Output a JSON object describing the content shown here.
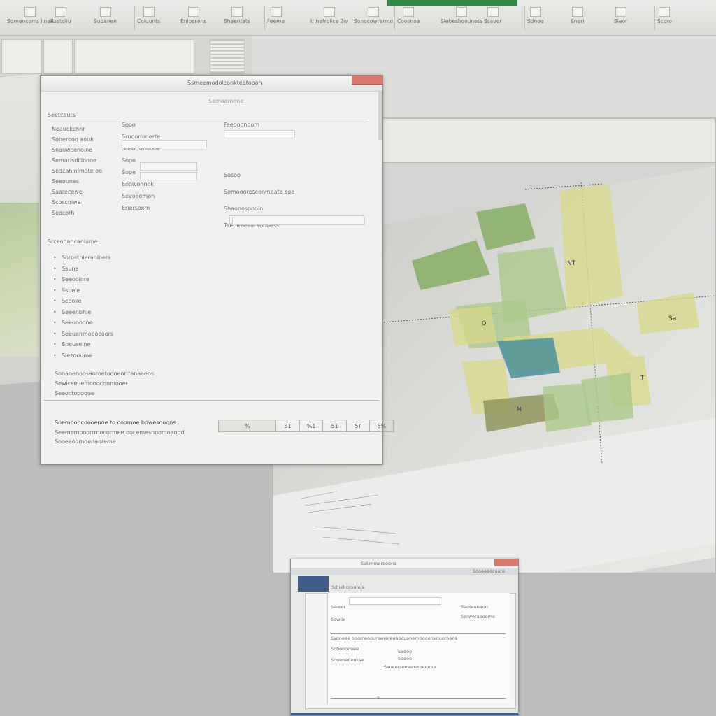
{
  "ribbon": {
    "tab_accent": "#2f8a43",
    "items": [
      {
        "label": "Sdmencoms lines",
        "icon": "table-icon"
      },
      {
        "label": "Rsstdiiu",
        "icon": "doc-icon"
      },
      {
        "label": "Sudanen",
        "icon": "doc-icon"
      },
      {
        "label": "Coiuunts",
        "icon": "grid-icon"
      },
      {
        "label": "Enlossons",
        "icon": "chart-icon"
      },
      {
        "label": "Shaentats",
        "icon": "shape-icon"
      },
      {
        "label": "Feeme",
        "icon": "doc-icon"
      },
      {
        "label": "Ir hefrolice 2w",
        "icon": "doc-icon"
      },
      {
        "label": "Sonocowrarmo",
        "icon": "doc-icon"
      },
      {
        "label": "Coosnoe",
        "icon": "chart-icon"
      },
      {
        "label": "Siebeshoouness",
        "icon": "list-icon"
      },
      {
        "label": "Ssaver",
        "icon": "doc-icon"
      },
      {
        "label": "Sdnoe",
        "icon": "image-icon"
      },
      {
        "label": "Sneri",
        "icon": "shape-icon"
      },
      {
        "label": "Siaor",
        "icon": "doc-icon"
      },
      {
        "label": "Scoro",
        "icon": "shape-icon"
      }
    ]
  },
  "dialog": {
    "title": "Ssmeemodolconkteatooon",
    "subtitle": "Semoemone",
    "section": "Seetcauts",
    "left_labels": [
      "Noauckshnr",
      "Sonerooo aouk",
      "Snauwcenoine",
      "Semarisdiiionoe",
      "Sedcahinimate oo",
      "Seeounes",
      "Saarecewe",
      "Scoscoiwa",
      "Soocorh"
    ],
    "mid_labels": [
      "Sooo",
      "Sruoommerte",
      "Soeoduuuooe",
      "Sopn",
      "Sope",
      "Eoowonnok",
      "Sevooomon",
      "Eriersoxm"
    ],
    "right_header": "Faeooonoom",
    "right_labels": [
      "Sosoo",
      "Semoooresconmaate soe",
      "Shaonosonoin",
      "Teeneeeearaonoess"
    ],
    "list_header": "Srceonancaniome",
    "list_items": [
      "Sorostnieraniners",
      "Ssune",
      "Seeooiore",
      "Ssuele",
      "Scooke",
      "Seeenbhie",
      "Seeuooone",
      "Seeuanmooocoors",
      "Sneuseine",
      "Siezooume"
    ],
    "footnotes": [
      "Sonanenoosaoroetoooeor tanaaeos",
      "Sewicseuemoooconmooer",
      "Seeoctooooue"
    ],
    "bottom_title": "Soemooncoooenoe to coomoe bowesooons",
    "bottom_lines": [
      "Seememooorrrnocormee oocemesnoomoeood",
      "Sooeeoomoonaoreme"
    ],
    "table": [
      "%",
      "31",
      "%1",
      "51",
      "5T",
      "8%"
    ]
  },
  "chart": {
    "labels": [
      "NT",
      "Sa",
      "Q",
      "M",
      "T"
    ],
    "colors": {
      "green": "#7fab5a",
      "light_green": "#a9c98b",
      "yellow": "#d9d98a",
      "teal": "#3d8a9a",
      "olive": "#8a8f55"
    }
  },
  "small_dialog": {
    "title": "Sakmmerooons",
    "tab_label": "Sdhelroronnos",
    "header_right": "Sooeeeosoure",
    "labels": [
      "Seeon",
      "Sowoe",
      "Saoteunaon",
      "Serweraeoome",
      "Sobooonoee",
      "Snoeoedeokse"
    ],
    "note": "Sxonoee ooomeoourswroreeaocuonemoooonxnuoroeos",
    "options": [
      "Soeoo",
      "Soeoo"
    ],
    "footer": "Ssneersomeneonoome",
    "status": "S"
  }
}
